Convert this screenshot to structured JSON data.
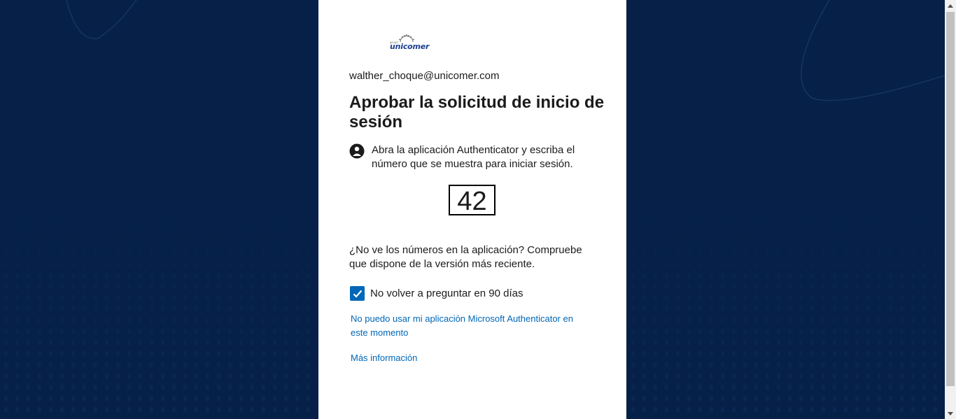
{
  "brand": {
    "logo_text": "unicomer",
    "logo_color": "#1c3f8f"
  },
  "account": {
    "email": "walther_choque@unicomer.com"
  },
  "main": {
    "title": "Aprobar la solicitud de inicio de sesión",
    "instruction": "Abra la aplicación Authenticator y escriba el número que se muestra para iniciar sesión.",
    "instruction_icon": "authenticator-lock-icon",
    "number": "42",
    "help_text": "¿No ve los números en la aplicación? Compruebe que dispone de la versión más reciente.",
    "remember": {
      "label": "No volver a preguntar en 90 días",
      "checked": true
    },
    "links": {
      "cant_use_app": "No puedo usar mi aplicación Microsoft Authenticator en este momento",
      "more_info": "Más información"
    }
  },
  "colors": {
    "background": "#062048",
    "card": "#ffffff",
    "link": "#0067b8",
    "checkbox": "#0067b8"
  }
}
